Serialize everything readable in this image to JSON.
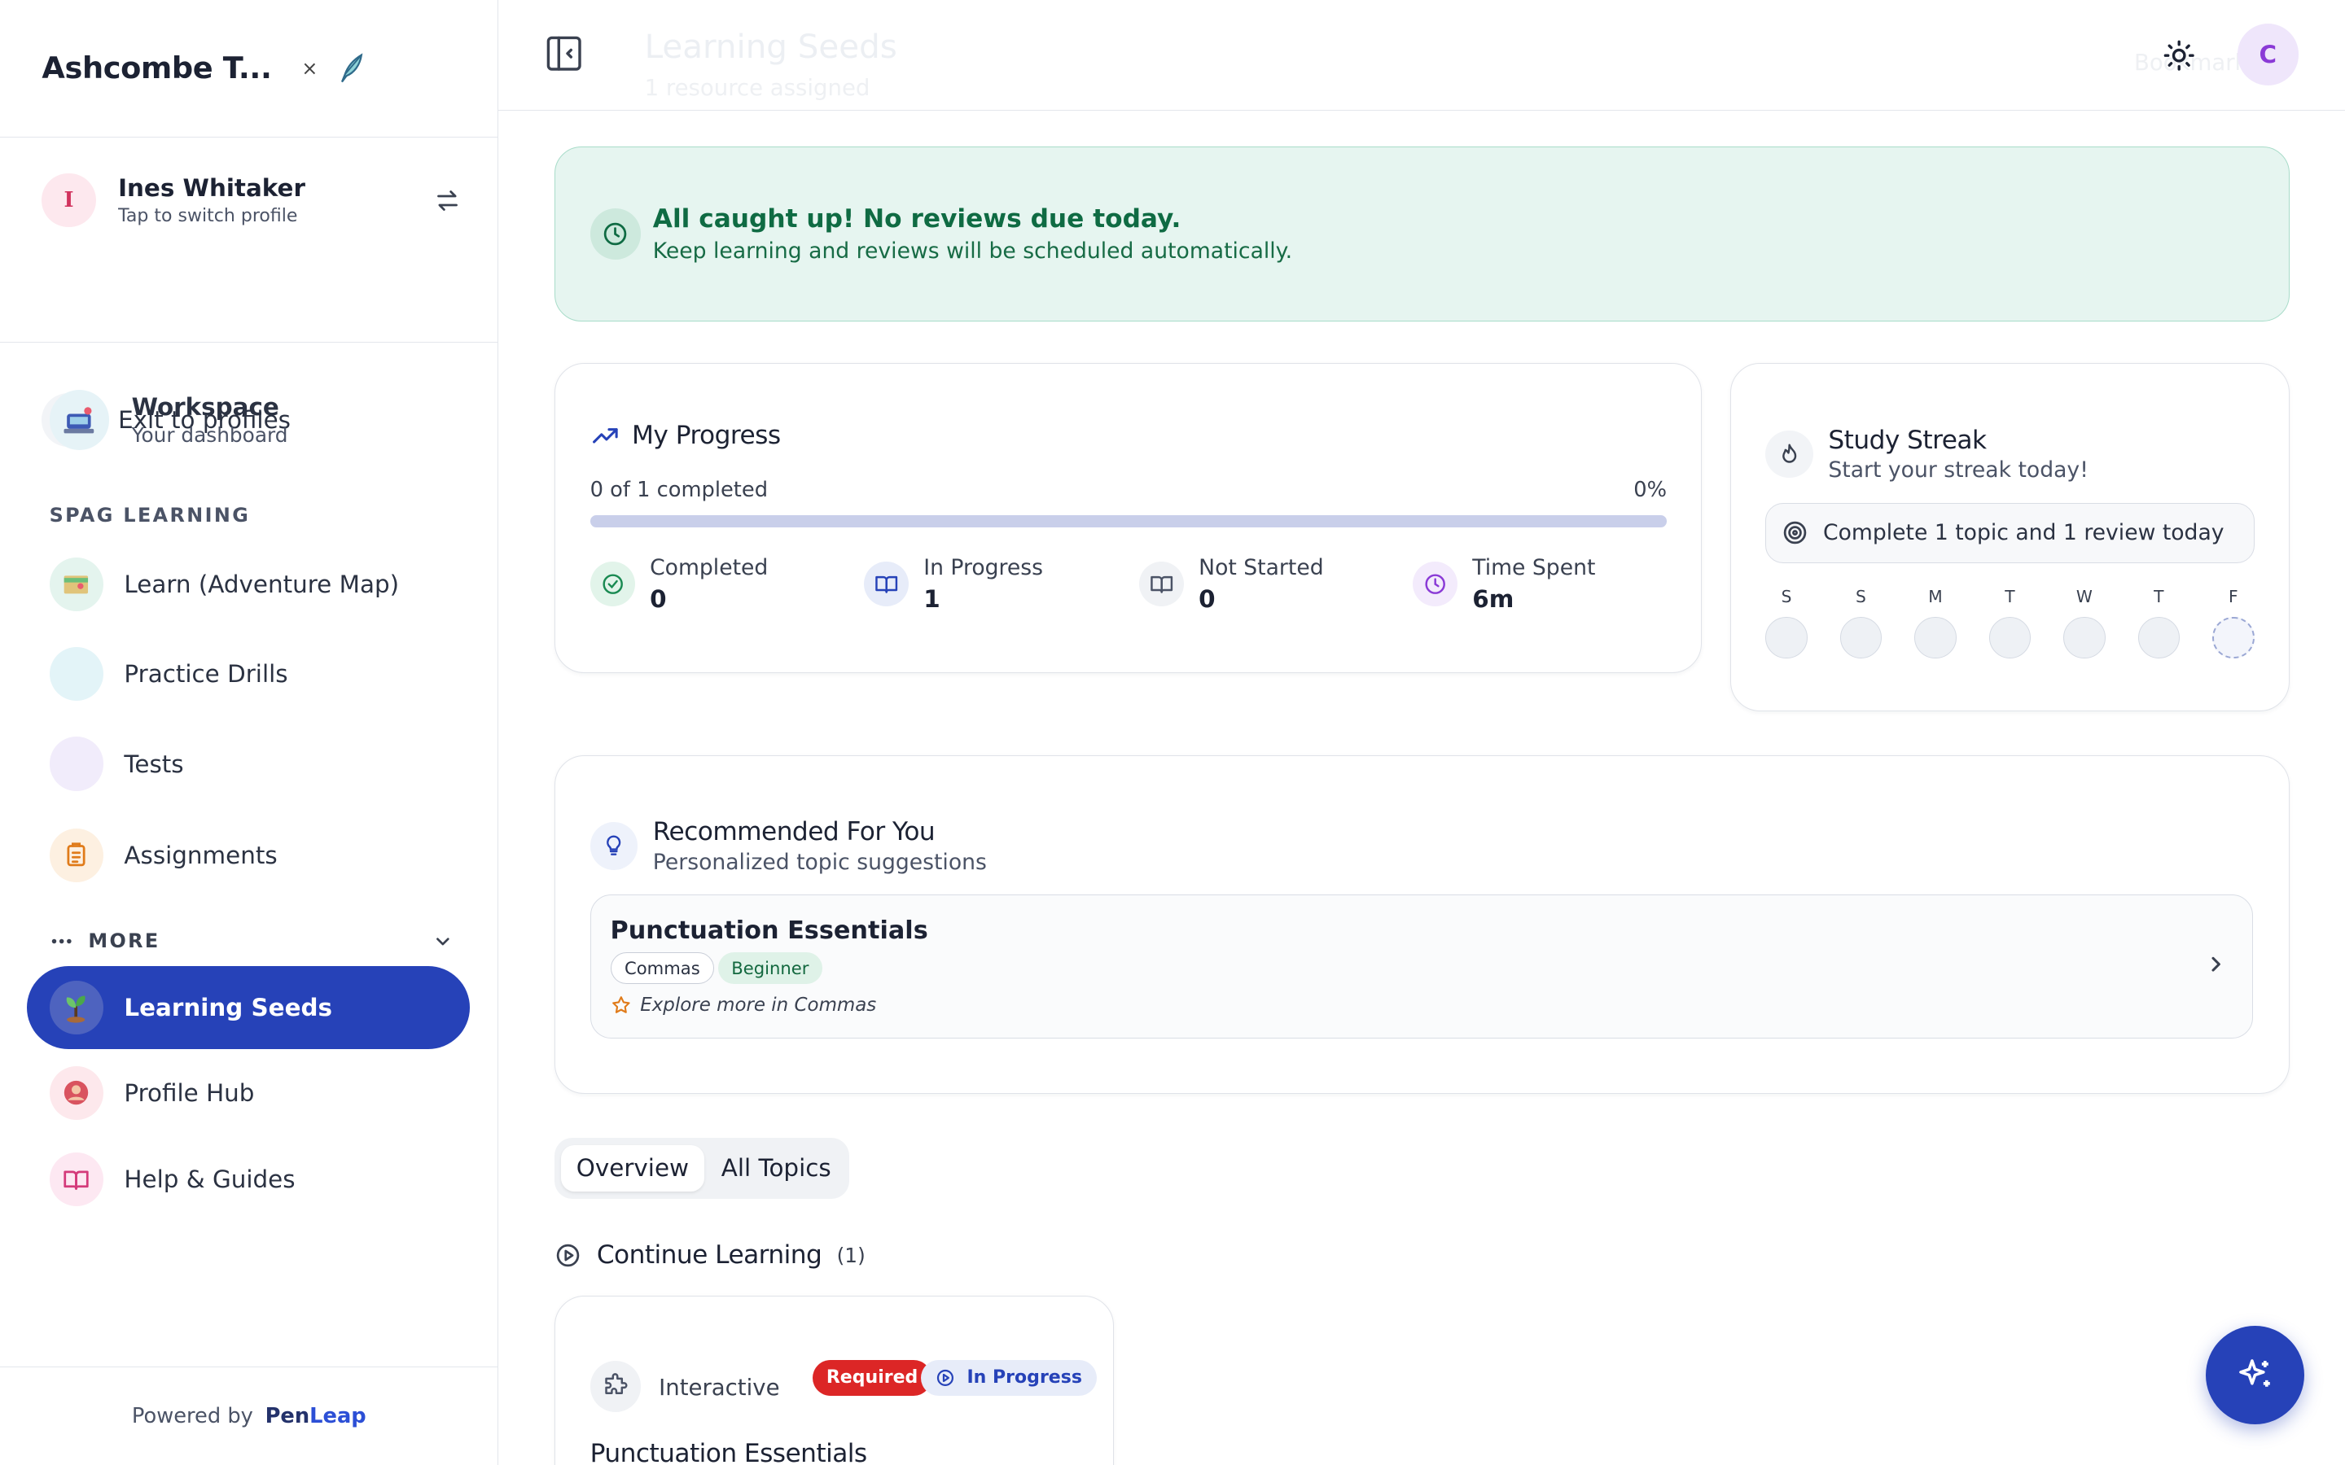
{
  "brand": {
    "title": "Ashcombe T...",
    "close_glyph": "×",
    "icon": "quill-icon"
  },
  "profile": {
    "initial": "I",
    "name": "Ines Whitaker",
    "subtitle": "Tap to switch profile",
    "exit_label": "Exit to profiles"
  },
  "sidebar": {
    "workspace": {
      "title": "Workspace",
      "subtitle": "Your dashboard"
    },
    "section_label": "SPAG LEARNING",
    "items": [
      {
        "label": "Learn (Adventure Map)",
        "icon": "map-icon"
      },
      {
        "label": "Practice Drills",
        "icon": "drill-icon"
      },
      {
        "label": "Tests",
        "icon": "test-icon"
      },
      {
        "label": "Assignments",
        "icon": "clipboard-icon"
      }
    ],
    "more_label": "MORE",
    "more_items": [
      {
        "label": "Learning Seeds",
        "icon": "sprout-icon",
        "active": true
      },
      {
        "label": "Profile Hub",
        "icon": "profile-icon"
      },
      {
        "label": "Help & Guides",
        "icon": "book-icon"
      }
    ],
    "footer": {
      "prefix": "Powered by",
      "brand_a": "Pen",
      "brand_b": "Leap"
    }
  },
  "topbar": {
    "page_title": "Learning Seeds",
    "page_subtitle": "1 resource assigned",
    "right_ghost": "Bookmarks",
    "user_initial": "C"
  },
  "banner": {
    "title": "All caught up! No reviews due today.",
    "subtitle": "Keep learning and reviews will be scheduled automatically."
  },
  "progress": {
    "title": "My Progress",
    "completed_text": "0 of 1 completed",
    "percent_text": "0%",
    "percent": 0,
    "stats": [
      {
        "label": "Completed",
        "value": "0"
      },
      {
        "label": "In Progress",
        "value": "1"
      },
      {
        "label": "Not Started",
        "value": "0"
      },
      {
        "label": "Time Spent",
        "value": "6m"
      }
    ]
  },
  "streak": {
    "title": "Study Streak",
    "subtitle": "Start your streak today!",
    "goal": "Complete 1 topic and 1 review today",
    "days": [
      "S",
      "S",
      "M",
      "T",
      "W",
      "T",
      "F"
    ],
    "today_index": 6
  },
  "recommended": {
    "title": "Recommended For You",
    "subtitle": "Personalized topic suggestions",
    "item": {
      "title": "Punctuation Essentials",
      "tags": [
        "Commas",
        "Beginner"
      ],
      "explore": "Explore more in Commas"
    }
  },
  "tabs": [
    "Overview",
    "All Topics"
  ],
  "continue": {
    "title": "Continue Learning",
    "count": "(1)",
    "card": {
      "type": "Interactive",
      "badge_required": "Required",
      "badge_status": "In Progress",
      "name": "Punctuation Essentials"
    }
  },
  "colors": {
    "accent": "#2642b8",
    "success": "#0f6b43",
    "danger": "#dc2626"
  }
}
